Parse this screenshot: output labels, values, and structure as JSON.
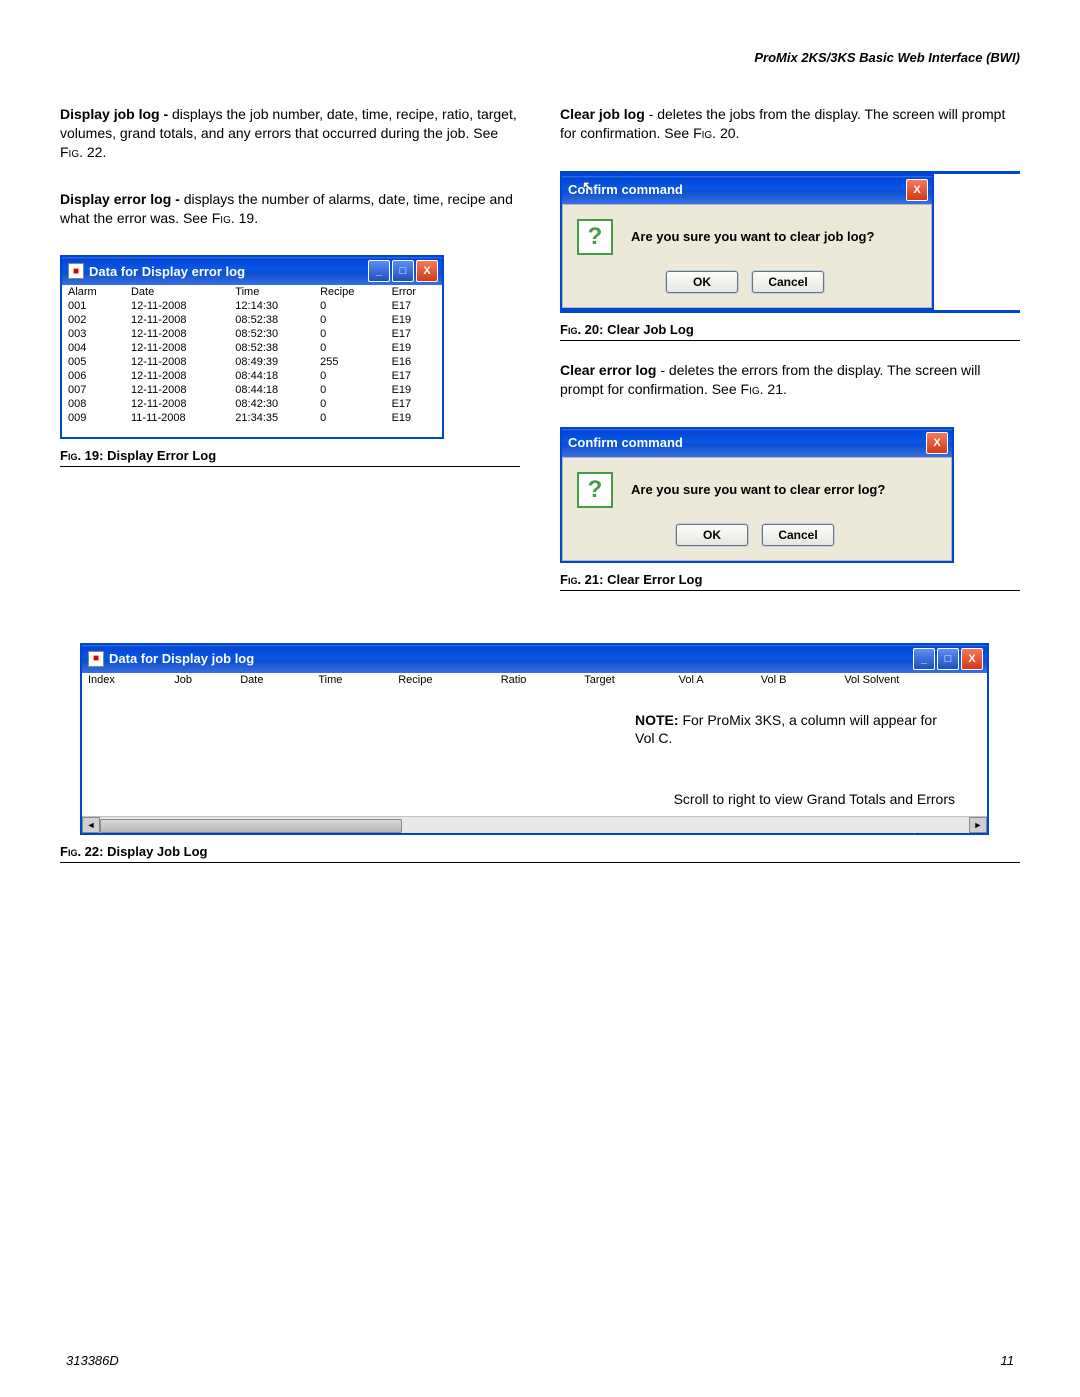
{
  "header": {
    "title": "ProMix 2KS/3KS Basic Web Interface (BWI)"
  },
  "left": {
    "para1a": "Display job log - ",
    "para1b": "displays the job number, date, time, recipe, ratio, target, volumes, grand totals, and any errors that occurred during the job. See ",
    "para1c": "Fig",
    "para1d": ". 22.",
    "para2a": "Display error log - ",
    "para2b": "displays the number of alarms, date, time, recipe and what the error was. See ",
    "para2c": "Fig",
    "para2d": ". 19."
  },
  "right": {
    "para1a": "Clear job log ",
    "para1b": "- deletes the jobs from the display. The screen will prompt for confirmation. See ",
    "para1c": "Fig",
    "para1d": ". 20.",
    "para2a": "Clear error log ",
    "para2b": "- deletes the errors from the display. The screen will prompt for confirmation. See ",
    "para2c": "Fig",
    "para2d": ". 21."
  },
  "errorLogWindow": {
    "title": "Data for Display error log",
    "headers": [
      "Alarm",
      "Date",
      "Time",
      "Recipe",
      "Error"
    ],
    "rows": [
      [
        "001",
        "12-11-2008",
        "12:14:30",
        "0",
        "E17"
      ],
      [
        "002",
        "12-11-2008",
        "08:52:38",
        "0",
        "E19"
      ],
      [
        "003",
        "12-11-2008",
        "08:52:30",
        "0",
        "E17"
      ],
      [
        "004",
        "12-11-2008",
        "08:52:38",
        "0",
        "E19"
      ],
      [
        "005",
        "12-11-2008",
        "08:49:39",
        "255",
        "E16"
      ],
      [
        "006",
        "12-11-2008",
        "08:44:18",
        "0",
        "E17"
      ],
      [
        "007",
        "12-11-2008",
        "08:44:18",
        "0",
        "E19"
      ],
      [
        "008",
        "12-11-2008",
        "08:42:30",
        "0",
        "E17"
      ],
      [
        "009",
        "11-11-2008",
        "21:34:35",
        "0",
        "E19"
      ]
    ]
  },
  "confirm": {
    "title": "Confirm command",
    "jobMsg": "Are you sure you want to clear job log?",
    "errMsg": "Are you sure you want to clear error log?",
    "ok": "OK",
    "cancel": "Cancel"
  },
  "jobLogWindow": {
    "title": "Data for Display job log",
    "headers": [
      "Index",
      "Job",
      "Date",
      "Time",
      "Recipe",
      "Ratio",
      "Target",
      "Vol A",
      "Vol B",
      "Vol Solvent"
    ],
    "note_bold": "NOTE:",
    "note_rest": " For ProMix 3KS, a column will appear for Vol C.",
    "scrollNote": "Scroll to right to view Grand Totals and Errors"
  },
  "captions": {
    "fig19": ". 19: Display Error Log",
    "fig20": ". 20: Clear Job Log",
    "fig21": ". 21: Clear Error Log",
    "fig22": ". 22: Display Job Log",
    "figWord": "Fig"
  },
  "footer": {
    "doc": "313386D",
    "page": "11"
  },
  "glyphs": {
    "min": "_",
    "max": "□",
    "close": "X",
    "left": "◄",
    "right": "►",
    "q": "?"
  }
}
